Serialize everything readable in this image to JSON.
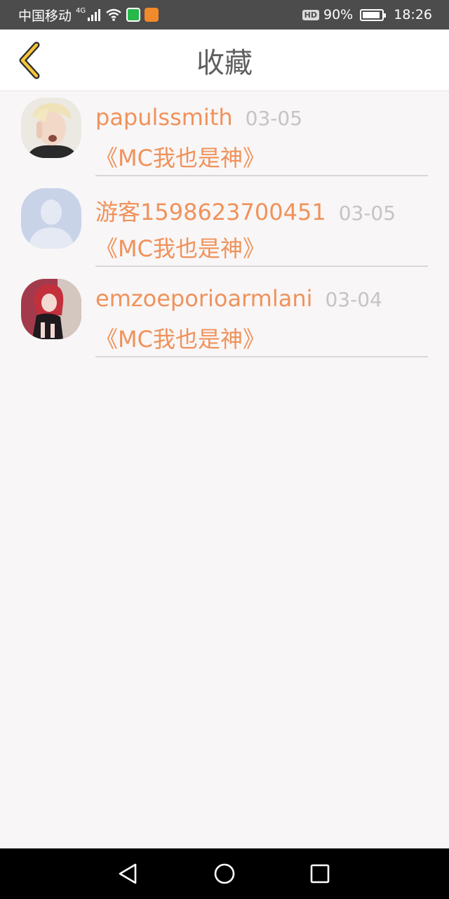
{
  "status_bar": {
    "carrier": "中国移动",
    "network": "4G",
    "battery_percent": "90%",
    "battery_level": 0.9,
    "time": "18:26",
    "hd_label": "HD",
    "icons": [
      "signal-icon",
      "wifi-icon",
      "app-icon-green",
      "app-icon-orange"
    ]
  },
  "header": {
    "title": "收藏",
    "back_icon": "chevron-left-icon"
  },
  "favorites": [
    {
      "name": "papulssmith",
      "date": "03-05",
      "title": "《MC我也是神》",
      "avatar": "photo-blond-man"
    },
    {
      "name": "游客1598623700451",
      "date": "03-05",
      "title": "《MC我也是神》",
      "avatar": "default-person-silhouette"
    },
    {
      "name": "emzoeporioarmlani",
      "date": "03-04",
      "title": "《MC我也是神》",
      "avatar": "photo-red-hair-girl"
    }
  ],
  "system_nav": {
    "back_icon": "triangle-back-icon",
    "home_icon": "circle-home-icon",
    "recents_icon": "square-recents-icon"
  },
  "colors": {
    "accent": "#f0925a",
    "date": "#c4c4c4",
    "title": "#606060",
    "back_chevron": "#f5c53a",
    "status_bar": "#4c4c4c"
  }
}
